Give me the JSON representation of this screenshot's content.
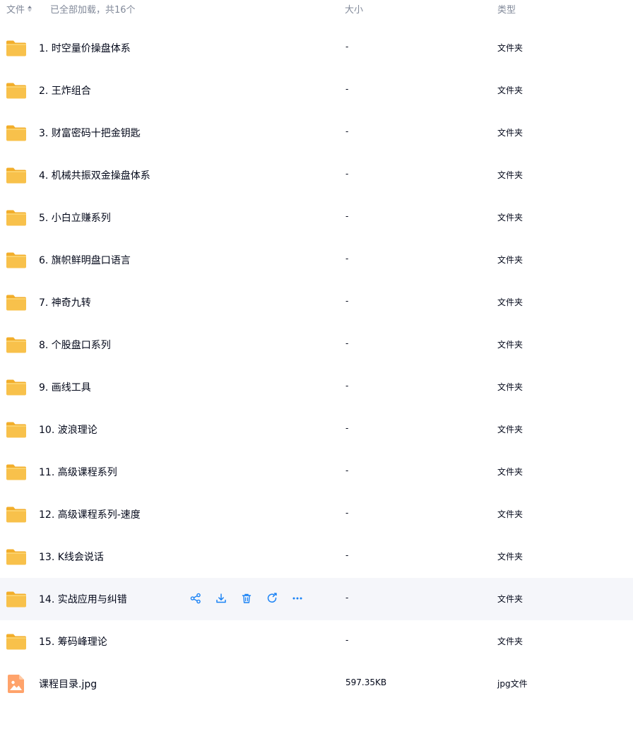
{
  "header": {
    "name_label": "文件",
    "status": "已全部加载，共16个",
    "size_label": "大小",
    "type_label": "类型"
  },
  "colors": {
    "folder": "#f8c14b",
    "image_file": "#ffa36b",
    "action_icon": "#1b83f5",
    "hover_row": "#f5f6fa"
  },
  "files": [
    {
      "name": "1. 时空量价操盘体系",
      "size": "-",
      "type": "文件夹",
      "icon": "folder-icon"
    },
    {
      "name": "2. 王炸组合",
      "size": "-",
      "type": "文件夹",
      "icon": "folder-icon"
    },
    {
      "name": "3. 财富密码十把金钥匙",
      "size": "-",
      "type": "文件夹",
      "icon": "folder-icon"
    },
    {
      "name": "4. 机械共振双金操盘体系",
      "size": "-",
      "type": "文件夹",
      "icon": "folder-icon"
    },
    {
      "name": "5. 小白立赚系列",
      "size": "-",
      "type": "文件夹",
      "icon": "folder-icon"
    },
    {
      "name": "6. 旗帜鲜明盘口语言",
      "size": "-",
      "type": "文件夹",
      "icon": "folder-icon"
    },
    {
      "name": "7. 神奇九转",
      "size": "-",
      "type": "文件夹",
      "icon": "folder-icon"
    },
    {
      "name": "8. 个股盘口系列",
      "size": "-",
      "type": "文件夹",
      "icon": "folder-icon"
    },
    {
      "name": "9. 画线工具",
      "size": "-",
      "type": "文件夹",
      "icon": "folder-icon"
    },
    {
      "name": "10. 波浪理论",
      "size": "-",
      "type": "文件夹",
      "icon": "folder-icon"
    },
    {
      "name": "11. 高级课程系列",
      "size": "-",
      "type": "文件夹",
      "icon": "folder-icon"
    },
    {
      "name": "12. 高级课程系列-速度",
      "size": "-",
      "type": "文件夹",
      "icon": "folder-icon"
    },
    {
      "name": "13. K线会说话",
      "size": "-",
      "type": "文件夹",
      "icon": "folder-icon"
    },
    {
      "name": "14. 实战应用与纠错",
      "size": "-",
      "type": "文件夹",
      "icon": "folder-icon",
      "hovered": true
    },
    {
      "name": "15. 筹码峰理论",
      "size": "-",
      "type": "文件夹",
      "icon": "folder-icon"
    },
    {
      "name": "课程目录.jpg",
      "size": "597.35KB",
      "type": "jpg文件",
      "icon": "image-file-icon"
    }
  ],
  "row_actions": [
    "share-icon",
    "download-icon",
    "delete-icon",
    "rename-icon",
    "more-icon"
  ]
}
